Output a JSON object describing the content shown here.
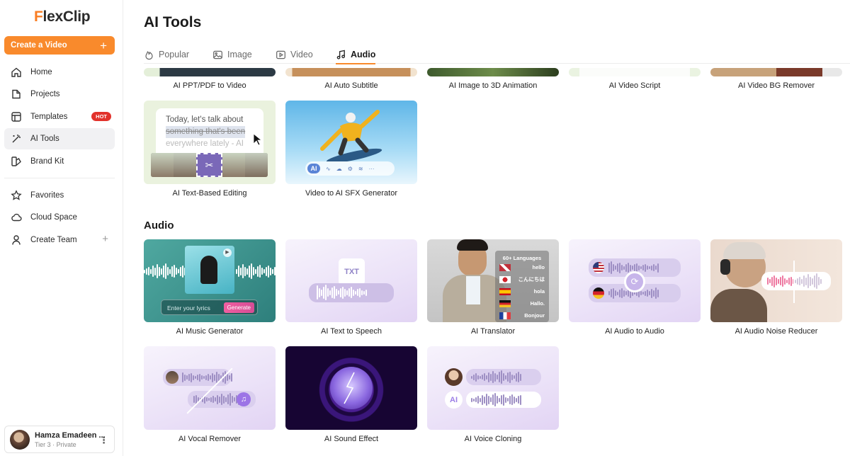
{
  "app": {
    "logo": "FlexClip",
    "logo_f": "F",
    "logo_rest": "lexClip"
  },
  "sidebar": {
    "create_label": "Create a Video",
    "create_plus": "+",
    "items": [
      {
        "label": "Home",
        "icon": "home-icon"
      },
      {
        "label": "Projects",
        "icon": "folder-icon"
      },
      {
        "label": "Templates",
        "icon": "templates-icon",
        "badge": "HOT"
      },
      {
        "label": "AI Tools",
        "icon": "magic-wand-icon",
        "active": true
      },
      {
        "label": "Brand Kit",
        "icon": "brand-kit-icon"
      },
      {
        "label": "Favorites",
        "icon": "star-icon"
      },
      {
        "label": "Cloud Space",
        "icon": "cloud-icon"
      },
      {
        "label": "Create Team",
        "icon": "user-icon",
        "action": "+"
      }
    ],
    "user": {
      "name": "Hamza Emadeen ...",
      "tier": "Tier 3 · Private",
      "menu": "⋮"
    }
  },
  "main": {
    "title": "AI Tools",
    "tabs": [
      {
        "label": "Popular",
        "icon": "flame-icon"
      },
      {
        "label": "Image",
        "icon": "image-icon"
      },
      {
        "label": "Video",
        "icon": "video-icon"
      },
      {
        "label": "Audio",
        "icon": "music-note-icon",
        "active": true
      }
    ],
    "top_cards": [
      {
        "label": "AI PPT/PDF to Video"
      },
      {
        "label": "AI Auto Subtitle"
      },
      {
        "label": "AI Image to 3D Animation"
      },
      {
        "label": "AI Video Script"
      },
      {
        "label": "AI Video BG Remover"
      }
    ],
    "video_cards": [
      {
        "label": "AI Text-Based Editing",
        "thumb_lines": [
          "Today, let's talk about",
          "something that's been",
          "everywhere lately - AI"
        ]
      },
      {
        "label": "Video to AI SFX Generator",
        "thumb_ai": "AI"
      }
    ],
    "audio_section_title": "Audio",
    "audio_cards": [
      {
        "label": "AI Music Generator",
        "thumb_input": "Enter your lyrics",
        "thumb_button": "Generate"
      },
      {
        "label": "AI Text to Speech",
        "thumb_text": "TXT"
      },
      {
        "label": "AI Translator",
        "thumb_header": "60+ Languages",
        "thumb_langs": [
          "hello",
          "こんにちは",
          "hola",
          "Hallo.",
          "Bonjour"
        ]
      },
      {
        "label": "AI Audio to Audio"
      },
      {
        "label": "AI Audio Noise Reducer"
      },
      {
        "label": "AI Vocal Remover"
      },
      {
        "label": "AI Sound Effect"
      },
      {
        "label": "AI Voice Cloning",
        "thumb_ai": "AI"
      }
    ]
  },
  "colors": {
    "accent": "#f98a2c",
    "hot": "#e2322b",
    "lavender": "#ece3f8"
  }
}
